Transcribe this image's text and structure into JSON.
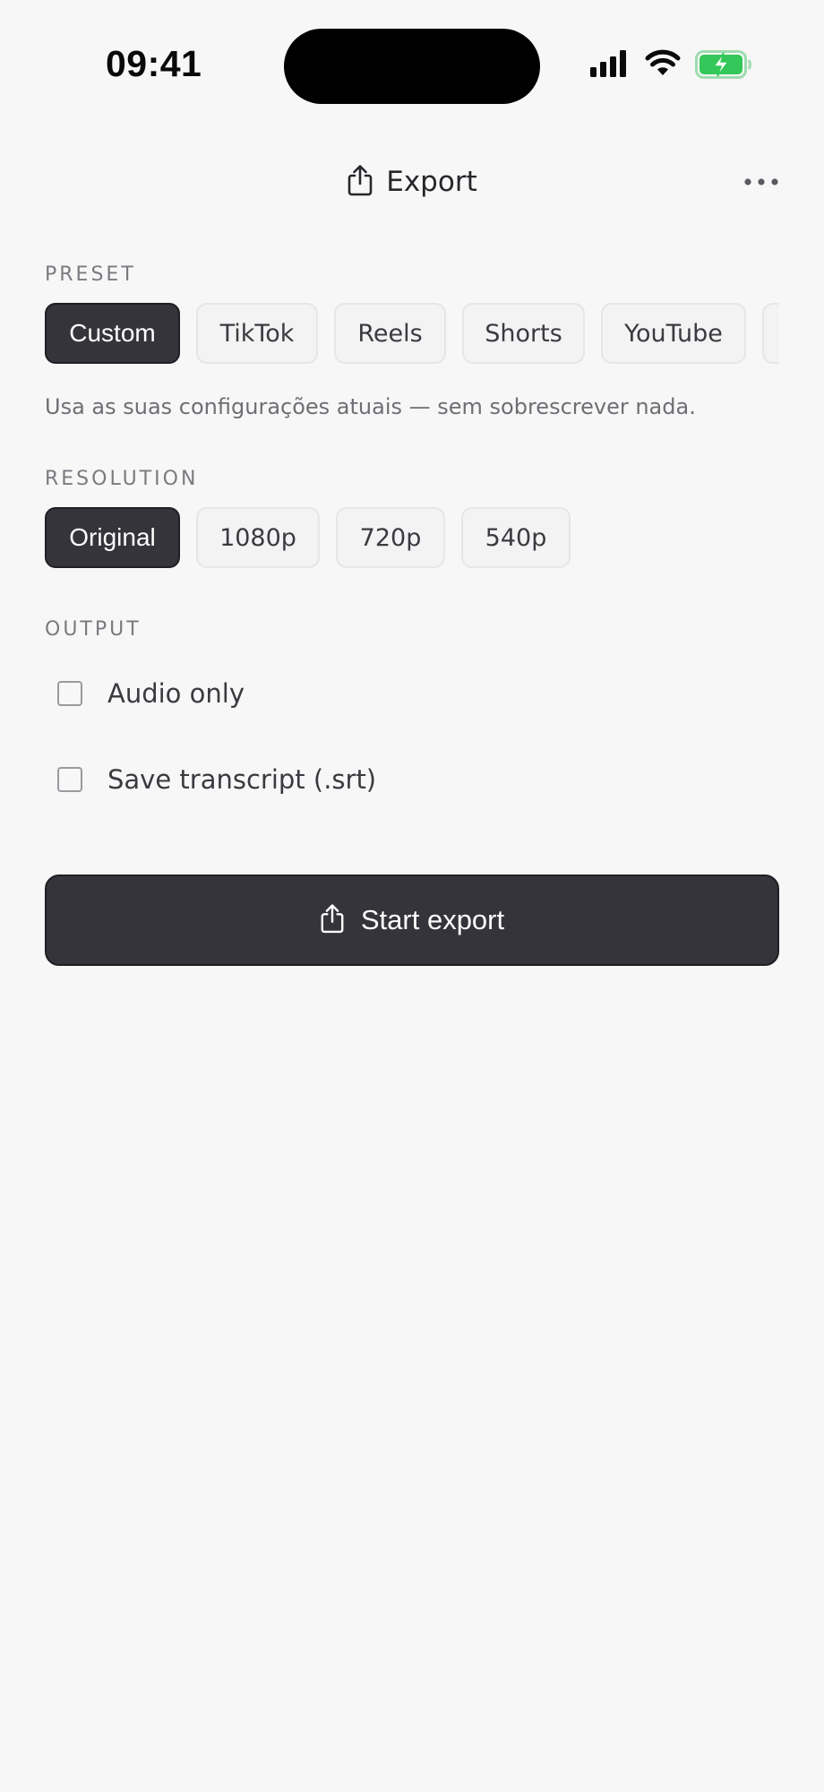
{
  "status_bar": {
    "time": "09:41"
  },
  "header": {
    "title": "Export",
    "title_icon": "share-icon",
    "more_icon": "more-horizontal-icon"
  },
  "preset": {
    "label": "PRESET",
    "selected": "Custom",
    "options": [
      "Custom",
      "TikTok",
      "Reels",
      "Shorts",
      "YouTube"
    ],
    "hint": "Usa as suas configurações atuais — sem sobrescrever nada."
  },
  "resolution": {
    "label": "RESOLUTION",
    "selected": "Original",
    "options": [
      "Original",
      "1080p",
      "720p",
      "540p"
    ]
  },
  "output": {
    "label": "OUTPUT",
    "options": [
      {
        "label": "Audio only",
        "checked": false
      },
      {
        "label": "Save transcript (.srt)",
        "checked": false
      }
    ]
  },
  "start_button": {
    "label": "Start export",
    "icon": "share-icon"
  },
  "colors": {
    "background": "#f7f7f7",
    "selected_chip": "#34343a",
    "battery_green": "#34c759"
  }
}
